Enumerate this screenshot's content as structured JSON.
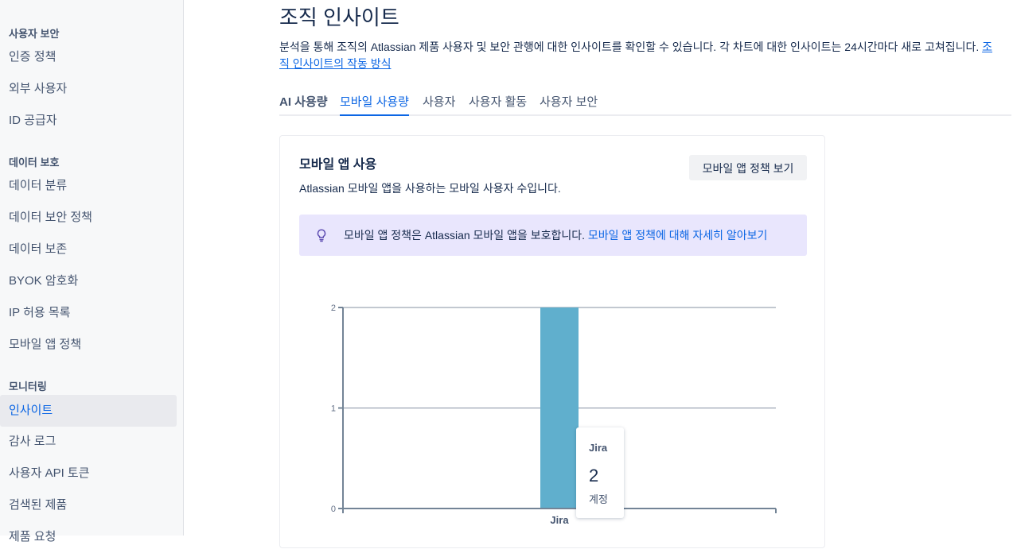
{
  "sidebar": {
    "sections": [
      {
        "heading": "사용자 보안",
        "items": [
          "인증 정책",
          "외부 사용자",
          "ID 공급자"
        ]
      },
      {
        "heading": "데이터 보호",
        "items": [
          "데이터 분류",
          "데이터 보안 정책",
          "데이터 보존",
          "BYOK 암호화",
          "IP 허용 목록",
          "모바일 앱 정책"
        ]
      },
      {
        "heading": "모니터링",
        "items": [
          "인사이트",
          "감사 로그",
          "사용자 API 토큰",
          "검색된 제품",
          "제품 요청"
        ]
      }
    ],
    "active_item": "인사이트"
  },
  "header": {
    "title": "조직 인사이트",
    "description": "분석을 통해 조직의 Atlassian 제품 사용자 및 보안 관행에 대한 인사이트를 확인할 수 있습니다. 각 차트에 대한 인사이트는 24시간마다 새로 고쳐집니다. ",
    "description_link": "조직 인사이트의 작동 방식"
  },
  "tabs": [
    {
      "label": "AI 사용량"
    },
    {
      "label": "모바일 사용량",
      "active": true
    },
    {
      "label": "사용자"
    },
    {
      "label": "사용자 활동"
    },
    {
      "label": "사용자 보안"
    }
  ],
  "card": {
    "title": "모바일 앱 사용",
    "subtitle": "Atlassian 모바일 앱을 사용하는 모바일 사용자 수입니다.",
    "button_label": "모바일 앱 정책 보기",
    "info_text": "모바일 앱 정책은 Atlassian 모바일 앱을 보호합니다. ",
    "info_link": "모바일 앱 정책에 대해 자세히 알아보기",
    "info_icon": "lightbulb-icon"
  },
  "chart_data": {
    "type": "bar",
    "categories": [
      "Jira"
    ],
    "values": [
      2
    ],
    "ylim": [
      0,
      2
    ],
    "yticks": [
      0,
      1,
      2
    ],
    "grid": true,
    "bar_color": "#60afcd"
  },
  "tooltip": {
    "label": "Jira",
    "value": "2",
    "unit": "계정"
  }
}
